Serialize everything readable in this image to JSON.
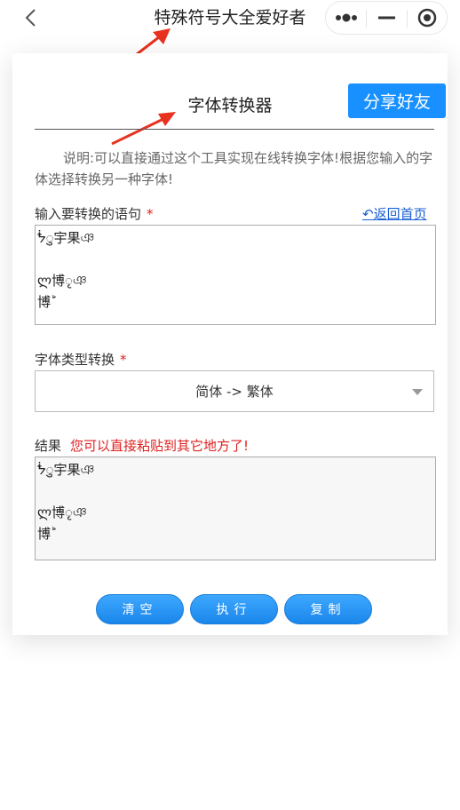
{
  "nav": {
    "title": "特殊符号大全爱好者"
  },
  "page": {
    "title": "字体转换器",
    "share_label": "分享好友",
    "description": "说明:可以直接通过这个工具实现在线转换字体!根据您输入的字体选择转换另一种字体!"
  },
  "input_section": {
    "label": "输入要转换的语句",
    "required_mark": "*",
    "back_link": "↶返回首页",
    "value": "ᖭ͏͏ु宇果ঞ\n\nლ博ृ͏ঞ\n博ؕ"
  },
  "font_type": {
    "label": "字体类型转换",
    "required_mark": "*",
    "selected": "简体 -> 繁体"
  },
  "result_section": {
    "label": "结果",
    "hint": "您可以直接粘贴到其它地方了!",
    "value": "ᖭ͏͏ु宇果ঞ\n\nლ博ृ͏ঞ\n博ؕ"
  },
  "actions": {
    "clear_label": "清空",
    "execute_label": "执行",
    "copy_label": "复制"
  },
  "colors": {
    "accent": "#1890ff",
    "annotation_arrow": "#e8321f",
    "required": "#e02020",
    "link": "#1a5fd6"
  }
}
